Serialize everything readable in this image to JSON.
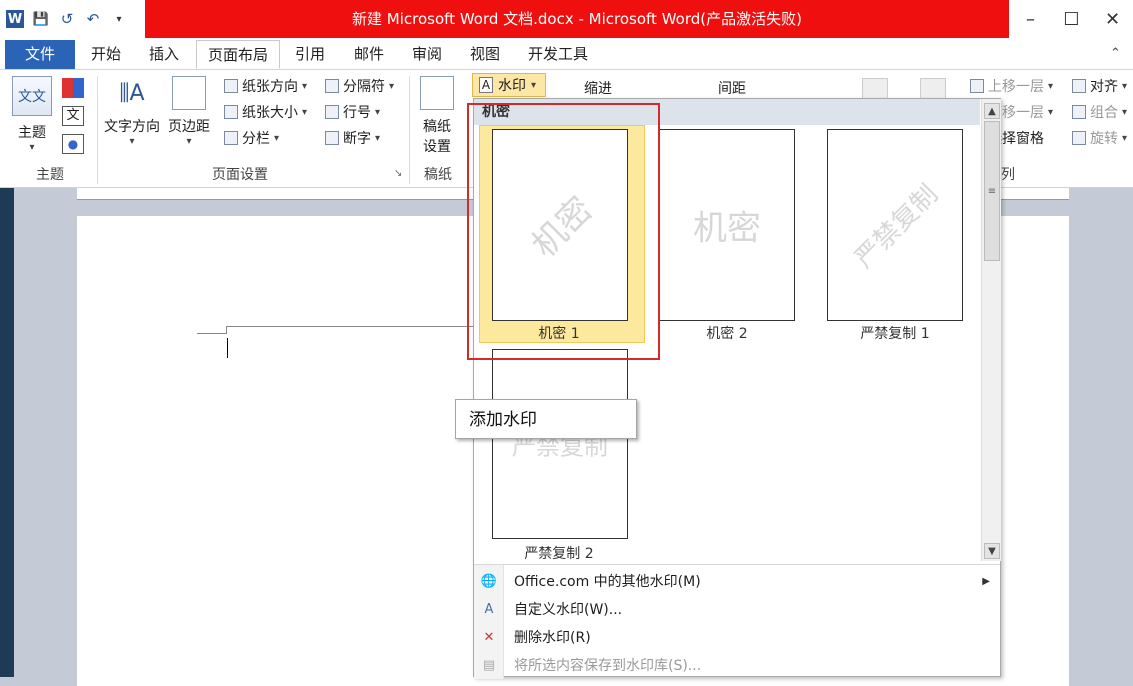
{
  "window": {
    "title": "新建 Microsoft Word 文档.docx - Microsoft Word(产品激活失败)",
    "controls": [
      "–",
      "☐",
      "✕"
    ]
  },
  "qat": {
    "app_icon": "W",
    "save": "💾",
    "undo": "↺",
    "redo": "↶"
  },
  "tabs": {
    "file": "文件",
    "items": [
      "开始",
      "插入",
      "页面布局",
      "引用",
      "邮件",
      "审阅",
      "视图",
      "开发工具"
    ],
    "active": "页面布局"
  },
  "ribbon": {
    "theme_group": {
      "label": "主题",
      "btn": "主题",
      "theme_icon": "文文"
    },
    "page_setup": {
      "label": "页面设置",
      "text_direction": "文字方向",
      "margins": "页边距",
      "orientation": "纸张方向",
      "size": "纸张大小",
      "columns": "分栏",
      "breaks": "分隔符",
      "line_numbers": "行号",
      "hyphenation": "断字"
    },
    "manuscript": {
      "label": "稿纸",
      "btn_line1": "稿纸",
      "btn_line2": "设置"
    },
    "watermark_btn": "水印",
    "indent": "缩进",
    "spacing": "间距",
    "arrange": {
      "bring_forward": "上移一层",
      "send_backward": "下移一层",
      "selection_pane": "选择窗格",
      "align": "对齐",
      "group": "组合",
      "rotate": "旋转",
      "label_tail": "列"
    }
  },
  "watermark_menu": {
    "category": "机密",
    "tiles": [
      {
        "label": "机密 1",
        "mark": "机密",
        "style": "diagonal",
        "selected": true
      },
      {
        "label": "机密 2",
        "mark": "机密",
        "style": "horizontal",
        "selected": false
      },
      {
        "label": "严禁复制 1",
        "mark": "严禁复制",
        "style": "diagonal",
        "selected": false
      },
      {
        "label": "严禁复制 2",
        "mark": "严禁复制",
        "style": "horizontal",
        "selected": false
      }
    ],
    "items": [
      {
        "text": "Office.com 中的其他水印(M)",
        "icon": "🌐",
        "submenu": true,
        "disabled": false
      },
      {
        "text": "自定义水印(W)...",
        "icon": "A",
        "submenu": false,
        "disabled": false
      },
      {
        "text": "删除水印(R)",
        "icon": "✕",
        "submenu": false,
        "disabled": false
      },
      {
        "text": "将所选内容保存到水印库(S)...",
        "icon": "▤",
        "submenu": false,
        "disabled": true
      }
    ]
  },
  "tooltip": "添加水印"
}
